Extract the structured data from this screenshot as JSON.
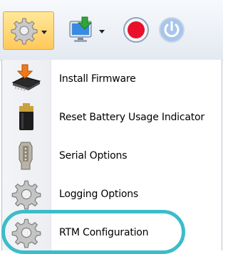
{
  "toolbar": {
    "buttons": [
      {
        "icon": "gear-icon",
        "has_dropdown": true,
        "active": true
      },
      {
        "icon": "monitor-download-icon",
        "has_dropdown": true,
        "active": false
      },
      {
        "icon": "record-icon",
        "has_dropdown": false,
        "active": false
      },
      {
        "icon": "power-icon",
        "has_dropdown": false,
        "active": false
      }
    ]
  },
  "menu": {
    "items": [
      {
        "label": "Install Firmware",
        "icon": "firmware-chip-icon"
      },
      {
        "label": "Reset Battery Usage Indicator",
        "icon": "battery-icon"
      },
      {
        "label": "Serial Options",
        "icon": "serial-connector-icon"
      },
      {
        "label": "Logging Options",
        "icon": "gear-icon"
      },
      {
        "label": "RTM Configuration",
        "icon": "gear-icon"
      }
    ]
  },
  "colors": {
    "active_button": "#ffc95a",
    "record": "#e8102a",
    "highlight_ring": "#3cbcc9"
  }
}
